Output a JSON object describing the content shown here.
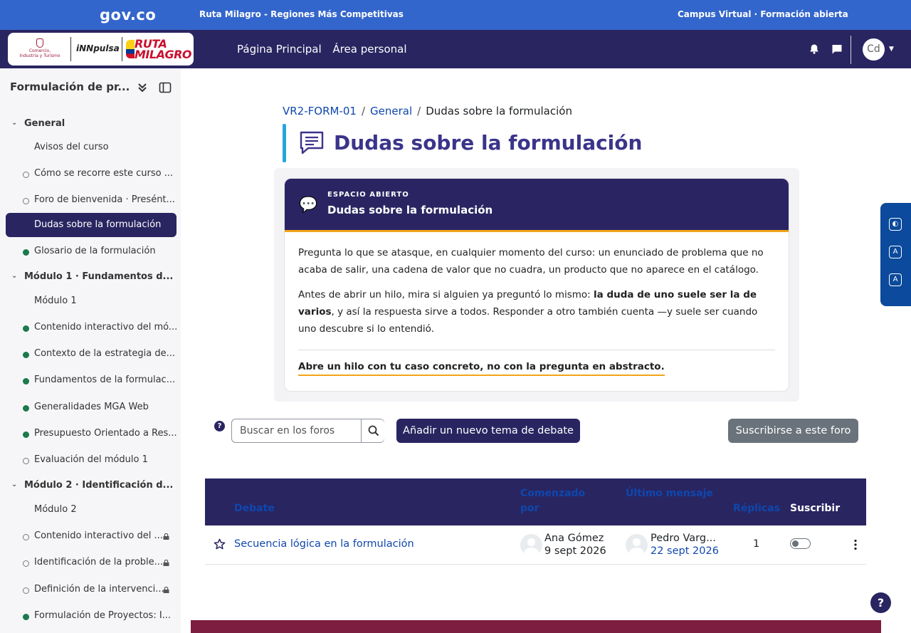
{
  "gov_bar": {
    "logo": "gov.co",
    "center_text": "Ruta Milagro - Regiones Más Competitivas",
    "right_text": "Campus Virtual · Formación abierta"
  },
  "brand": {
    "ministry_line1": "Comercio,",
    "ministry_line2": "Industria y Turismo",
    "innpulsa": "iNNpulsa",
    "ruta_line1": "RUTA",
    "ruta_line2": "MILAGRO"
  },
  "nav": {
    "links": [
      "Página Principal",
      "Área personal"
    ],
    "avatar_initials": "Cd"
  },
  "sidebar": {
    "course_title": "Formulación de pr...",
    "items": [
      {
        "kind": "section",
        "label": "General"
      },
      {
        "kind": "leaf",
        "label": "Avisos del curso",
        "status": "none"
      },
      {
        "kind": "leaf",
        "label": "Cómo se recorre este curso ...",
        "status": "open"
      },
      {
        "kind": "leaf",
        "label": "Foro de bienvenida · Presént...",
        "status": "open"
      },
      {
        "kind": "leaf",
        "label": "Dudas sobre la formulación",
        "status": "active"
      },
      {
        "kind": "leaf",
        "label": "Glosario de la formulación",
        "status": "done"
      },
      {
        "kind": "section",
        "label": "Módulo 1 · Fundamentos d..."
      },
      {
        "kind": "leaf",
        "label": "Módulo 1",
        "status": "none"
      },
      {
        "kind": "leaf",
        "label": "Contenido interactivo del mó...",
        "status": "done"
      },
      {
        "kind": "leaf",
        "label": "Contexto de la estrategia de...",
        "status": "done"
      },
      {
        "kind": "leaf",
        "label": "Fundamentos de la formulac...",
        "status": "done"
      },
      {
        "kind": "leaf",
        "label": "Generalidades MGA Web",
        "status": "done"
      },
      {
        "kind": "leaf",
        "label": "Presupuesto Orientado a Res...",
        "status": "done"
      },
      {
        "kind": "leaf",
        "label": "Evaluación del módulo 1",
        "status": "open"
      },
      {
        "kind": "section",
        "label": "Módulo 2 · Identificación d..."
      },
      {
        "kind": "leaf",
        "label": "Módulo 2",
        "status": "none"
      },
      {
        "kind": "leaf",
        "label": "Contenido interactivo del ...",
        "status": "open",
        "locked": true
      },
      {
        "kind": "leaf",
        "label": "Identificación de la proble...",
        "status": "open",
        "locked": true
      },
      {
        "kind": "leaf",
        "label": "Definición de la intervenci...",
        "status": "open",
        "locked": true
      },
      {
        "kind": "leaf",
        "label": "Formulación de Proyectos: I...",
        "status": "done"
      }
    ]
  },
  "breadcrumb": {
    "course": "VR2-FORM-01",
    "section": "General",
    "current": "Dudas sobre la formulación"
  },
  "page_title": "Dudas sobre la formulación",
  "intro": {
    "kicker": "ESPACIO ABIERTO",
    "title": "Dudas sobre la formulación",
    "p1": "Pregunta lo que se atasque, en cualquier momento del curso: un enunciado de problema que no acaba de salir, una cadena de valor que no cuadra, un producto que no aparece en el catálogo.",
    "p2_before": "Antes de abrir un hilo, mira si alguien ya preguntó lo mismo: ",
    "p2_bold": "la duda de uno suele ser la de varios",
    "p2_after": ", y así la respuesta sirve a todos. Responder a otro también cuenta —y suele ser cuando uno descubre si lo entendió.",
    "cta": "Abre un hilo con tu caso concreto, no con la pregunta en abstracto."
  },
  "toolbar": {
    "search_placeholder": "Buscar en los foros",
    "add_topic": "Añadir un nuevo tema de debate",
    "subscribe": "Suscribirse a este foro"
  },
  "table": {
    "headers": {
      "discussion": "Debate",
      "started_by_l1": "Comenzado",
      "started_by_l2": "por",
      "last_post": "Último mensaje",
      "replies": "Réplicas",
      "subscribe": "Suscribir"
    },
    "rows": [
      {
        "topic": "Secuencia lógica en la formulación",
        "starter_name": "Ana Gómez",
        "starter_date": "9 sept 2026",
        "last_name": "Pedro Varg...",
        "last_date": "22 sept 2026",
        "replies": "1"
      }
    ]
  },
  "colors": {
    "gov_blue": "#3366cc",
    "brand_navy": "#292561",
    "accent_orange": "#f2a51a",
    "link_blue": "#0f47ad",
    "footer_wine": "#7d1d3f"
  }
}
